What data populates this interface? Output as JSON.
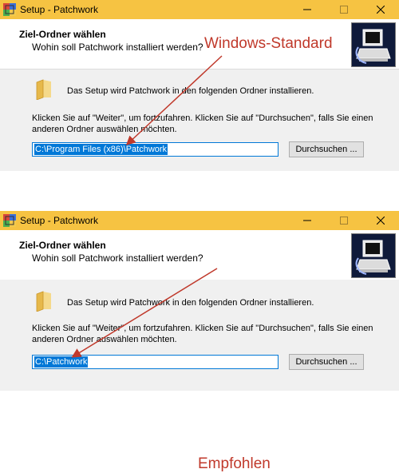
{
  "colors": {
    "titlebar": "#f6c342",
    "annotation": "#c0392b",
    "selection": "#0078d7",
    "dialog_body": "#f0f0f0"
  },
  "icons": {
    "app": "patchwork-installer-icon",
    "folder": "folder-icon",
    "logo": "computer-install-logo"
  },
  "dialogs": [
    {
      "window_title": "Setup - Patchwork",
      "header_title": "Ziel-Ordner wählen",
      "header_subtitle": "Wohin soll Patchwork installiert werden?",
      "info_text": "Das Setup wird Patchwork in den folgenden Ordner installieren.",
      "instructions": "Klicken Sie auf \"Weiter\", um fortzufahren. Klicken Sie auf \"Durchsuchen\", falls Sie einen anderen Ordner auswählen möchten.",
      "path_value": "C:\\Program Files (x86)\\Patchwork",
      "browse_label": "Durchsuchen ...",
      "annotation": "Windows-Standard"
    },
    {
      "window_title": "Setup - Patchwork",
      "header_title": "Ziel-Ordner wählen",
      "header_subtitle": "Wohin soll Patchwork installiert werden?",
      "info_text": "Das Setup wird Patchwork in den folgenden Ordner installieren.",
      "instructions": "Klicken Sie auf \"Weiter\", um fortzufahren. Klicken Sie auf \"Durchsuchen\", falls Sie einen anderen Ordner auswählen möchten.",
      "path_value": "C:\\Patchwork",
      "browse_label": "Durchsuchen ...",
      "annotation": "Empfohlen"
    }
  ]
}
